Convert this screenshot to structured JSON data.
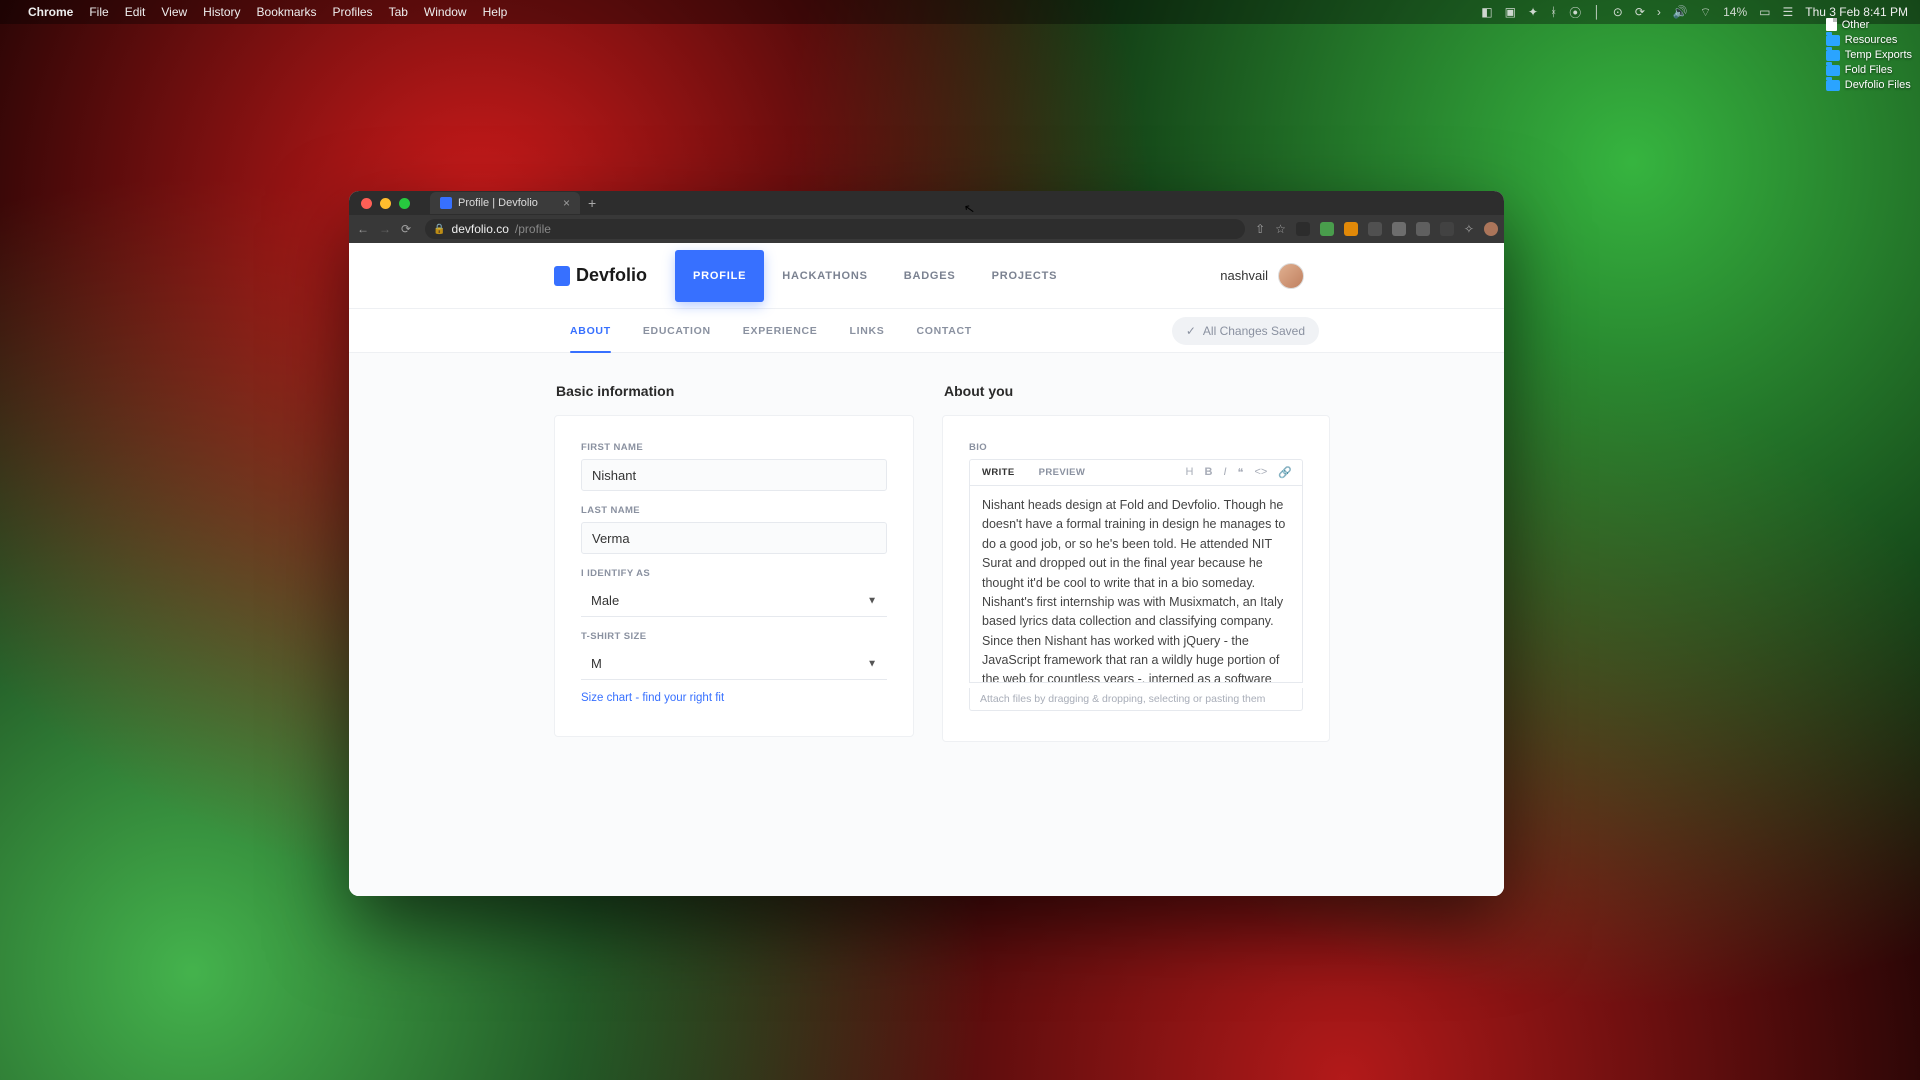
{
  "menubar": {
    "app": "Chrome",
    "items": [
      "File",
      "Edit",
      "View",
      "History",
      "Bookmarks",
      "Profiles",
      "Tab",
      "Window",
      "Help"
    ],
    "battery": "14%",
    "clock": "Thu 3 Feb 8:41 PM"
  },
  "desktop": {
    "items": [
      {
        "label": "Other",
        "type": "file"
      },
      {
        "label": "Resources",
        "type": "folder"
      },
      {
        "label": "Temp Exports",
        "type": "folder"
      },
      {
        "label": "Fold Files",
        "type": "folder"
      },
      {
        "label": "Devfolio Files",
        "type": "folder"
      }
    ]
  },
  "browser": {
    "tab_title": "Profile | Devfolio",
    "url_host": "devfolio.co",
    "url_path": "/profile"
  },
  "header": {
    "brand": "Devfolio",
    "tabs": [
      {
        "label": "PROFILE",
        "active": true
      },
      {
        "label": "HACKATHONS",
        "active": false
      },
      {
        "label": "BADGES",
        "active": false
      },
      {
        "label": "PROJECTS",
        "active": false
      }
    ],
    "username": "nashvail"
  },
  "subnav": {
    "tabs": [
      {
        "label": "ABOUT",
        "active": true
      },
      {
        "label": "EDUCATION",
        "active": false
      },
      {
        "label": "EXPERIENCE",
        "active": false
      },
      {
        "label": "LINKS",
        "active": false
      },
      {
        "label": "CONTACT",
        "active": false
      }
    ],
    "save_status": "All Changes Saved"
  },
  "basic": {
    "title": "Basic information",
    "first_name_label": "FIRST NAME",
    "first_name": "Nishant",
    "last_name_label": "LAST NAME",
    "last_name": "Verma",
    "identify_label": "I IDENTIFY AS",
    "identify_value": "Male",
    "tshirt_label": "T-SHIRT SIZE",
    "tshirt_value": "M",
    "size_link": "Size chart - find your right fit"
  },
  "about": {
    "title": "About you",
    "bio_label": "BIO",
    "write_tab": "WRITE",
    "preview_tab": "PREVIEW",
    "bio_text": "Nishant heads design at Fold and Devfolio. Though he doesn't have a formal training in design he manages to do a good job, or so he's been told. He attended NIT Surat and dropped out in the final year because he thought it'd be cool to write that in a bio someday. Nishant's first internship was with Musixmatch, an Italy based lyrics data collection and classifying company. Since then Nishant has worked with jQuery - the JavaScript framework that ran a wildly huge portion of the web for countless years -, interned as a software engineer at HackerRank, Razorpay and Zulip.",
    "hint": "Attach files by dragging & dropping, selecting or pasting them"
  }
}
